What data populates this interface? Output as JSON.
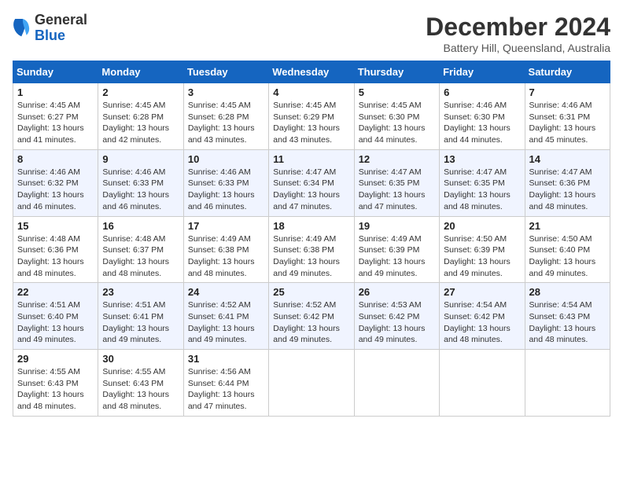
{
  "header": {
    "logo_general": "General",
    "logo_blue": "Blue",
    "title": "December 2024",
    "location": "Battery Hill, Queensland, Australia"
  },
  "days_of_week": [
    "Sunday",
    "Monday",
    "Tuesday",
    "Wednesday",
    "Thursday",
    "Friday",
    "Saturday"
  ],
  "weeks": [
    [
      {
        "day": "1",
        "sunrise": "Sunrise: 4:45 AM",
        "sunset": "Sunset: 6:27 PM",
        "daylight": "Daylight: 13 hours and 41 minutes."
      },
      {
        "day": "2",
        "sunrise": "Sunrise: 4:45 AM",
        "sunset": "Sunset: 6:28 PM",
        "daylight": "Daylight: 13 hours and 42 minutes."
      },
      {
        "day": "3",
        "sunrise": "Sunrise: 4:45 AM",
        "sunset": "Sunset: 6:28 PM",
        "daylight": "Daylight: 13 hours and 43 minutes."
      },
      {
        "day": "4",
        "sunrise": "Sunrise: 4:45 AM",
        "sunset": "Sunset: 6:29 PM",
        "daylight": "Daylight: 13 hours and 43 minutes."
      },
      {
        "day": "5",
        "sunrise": "Sunrise: 4:45 AM",
        "sunset": "Sunset: 6:30 PM",
        "daylight": "Daylight: 13 hours and 44 minutes."
      },
      {
        "day": "6",
        "sunrise": "Sunrise: 4:46 AM",
        "sunset": "Sunset: 6:30 PM",
        "daylight": "Daylight: 13 hours and 44 minutes."
      },
      {
        "day": "7",
        "sunrise": "Sunrise: 4:46 AM",
        "sunset": "Sunset: 6:31 PM",
        "daylight": "Daylight: 13 hours and 45 minutes."
      }
    ],
    [
      {
        "day": "8",
        "sunrise": "Sunrise: 4:46 AM",
        "sunset": "Sunset: 6:32 PM",
        "daylight": "Daylight: 13 hours and 46 minutes."
      },
      {
        "day": "9",
        "sunrise": "Sunrise: 4:46 AM",
        "sunset": "Sunset: 6:33 PM",
        "daylight": "Daylight: 13 hours and 46 minutes."
      },
      {
        "day": "10",
        "sunrise": "Sunrise: 4:46 AM",
        "sunset": "Sunset: 6:33 PM",
        "daylight": "Daylight: 13 hours and 46 minutes."
      },
      {
        "day": "11",
        "sunrise": "Sunrise: 4:47 AM",
        "sunset": "Sunset: 6:34 PM",
        "daylight": "Daylight: 13 hours and 47 minutes."
      },
      {
        "day": "12",
        "sunrise": "Sunrise: 4:47 AM",
        "sunset": "Sunset: 6:35 PM",
        "daylight": "Daylight: 13 hours and 47 minutes."
      },
      {
        "day": "13",
        "sunrise": "Sunrise: 4:47 AM",
        "sunset": "Sunset: 6:35 PM",
        "daylight": "Daylight: 13 hours and 48 minutes."
      },
      {
        "day": "14",
        "sunrise": "Sunrise: 4:47 AM",
        "sunset": "Sunset: 6:36 PM",
        "daylight": "Daylight: 13 hours and 48 minutes."
      }
    ],
    [
      {
        "day": "15",
        "sunrise": "Sunrise: 4:48 AM",
        "sunset": "Sunset: 6:36 PM",
        "daylight": "Daylight: 13 hours and 48 minutes."
      },
      {
        "day": "16",
        "sunrise": "Sunrise: 4:48 AM",
        "sunset": "Sunset: 6:37 PM",
        "daylight": "Daylight: 13 hours and 48 minutes."
      },
      {
        "day": "17",
        "sunrise": "Sunrise: 4:49 AM",
        "sunset": "Sunset: 6:38 PM",
        "daylight": "Daylight: 13 hours and 48 minutes."
      },
      {
        "day": "18",
        "sunrise": "Sunrise: 4:49 AM",
        "sunset": "Sunset: 6:38 PM",
        "daylight": "Daylight: 13 hours and 49 minutes."
      },
      {
        "day": "19",
        "sunrise": "Sunrise: 4:49 AM",
        "sunset": "Sunset: 6:39 PM",
        "daylight": "Daylight: 13 hours and 49 minutes."
      },
      {
        "day": "20",
        "sunrise": "Sunrise: 4:50 AM",
        "sunset": "Sunset: 6:39 PM",
        "daylight": "Daylight: 13 hours and 49 minutes."
      },
      {
        "day": "21",
        "sunrise": "Sunrise: 4:50 AM",
        "sunset": "Sunset: 6:40 PM",
        "daylight": "Daylight: 13 hours and 49 minutes."
      }
    ],
    [
      {
        "day": "22",
        "sunrise": "Sunrise: 4:51 AM",
        "sunset": "Sunset: 6:40 PM",
        "daylight": "Daylight: 13 hours and 49 minutes."
      },
      {
        "day": "23",
        "sunrise": "Sunrise: 4:51 AM",
        "sunset": "Sunset: 6:41 PM",
        "daylight": "Daylight: 13 hours and 49 minutes."
      },
      {
        "day": "24",
        "sunrise": "Sunrise: 4:52 AM",
        "sunset": "Sunset: 6:41 PM",
        "daylight": "Daylight: 13 hours and 49 minutes."
      },
      {
        "day": "25",
        "sunrise": "Sunrise: 4:52 AM",
        "sunset": "Sunset: 6:42 PM",
        "daylight": "Daylight: 13 hours and 49 minutes."
      },
      {
        "day": "26",
        "sunrise": "Sunrise: 4:53 AM",
        "sunset": "Sunset: 6:42 PM",
        "daylight": "Daylight: 13 hours and 49 minutes."
      },
      {
        "day": "27",
        "sunrise": "Sunrise: 4:54 AM",
        "sunset": "Sunset: 6:42 PM",
        "daylight": "Daylight: 13 hours and 48 minutes."
      },
      {
        "day": "28",
        "sunrise": "Sunrise: 4:54 AM",
        "sunset": "Sunset: 6:43 PM",
        "daylight": "Daylight: 13 hours and 48 minutes."
      }
    ],
    [
      {
        "day": "29",
        "sunrise": "Sunrise: 4:55 AM",
        "sunset": "Sunset: 6:43 PM",
        "daylight": "Daylight: 13 hours and 48 minutes."
      },
      {
        "day": "30",
        "sunrise": "Sunrise: 4:55 AM",
        "sunset": "Sunset: 6:43 PM",
        "daylight": "Daylight: 13 hours and 48 minutes."
      },
      {
        "day": "31",
        "sunrise": "Sunrise: 4:56 AM",
        "sunset": "Sunset: 6:44 PM",
        "daylight": "Daylight: 13 hours and 47 minutes."
      },
      null,
      null,
      null,
      null
    ]
  ]
}
